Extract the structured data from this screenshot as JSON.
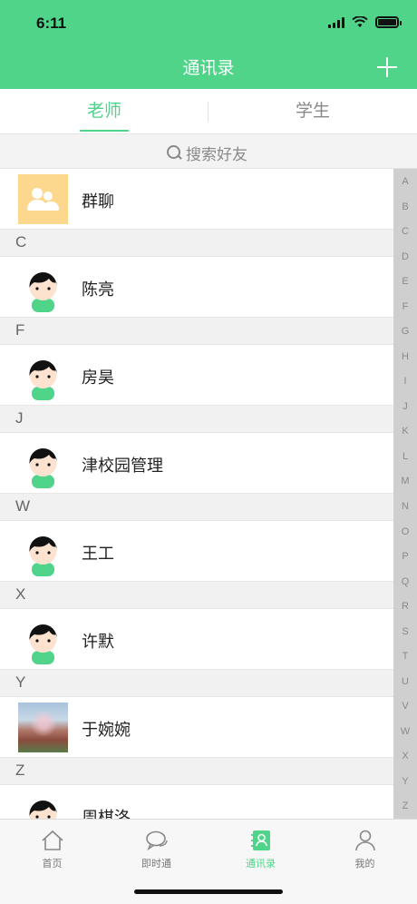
{
  "status_bar": {
    "time": "6:11"
  },
  "nav": {
    "title": "通讯录",
    "add_icon": "plus-icon"
  },
  "tabs": [
    {
      "label": "老师",
      "active": true
    },
    {
      "label": "学生",
      "active": false
    }
  ],
  "search": {
    "placeholder": "搜索好友",
    "icon": "search-icon"
  },
  "contacts": {
    "group": {
      "name": "群聊",
      "avatar": "group-chat-icon"
    },
    "sections": [
      {
        "letter": "C",
        "entries": [
          {
            "name": "陈亮",
            "avatar": "default-avatar"
          }
        ]
      },
      {
        "letter": "F",
        "entries": [
          {
            "name": "房昊",
            "avatar": "default-avatar"
          }
        ]
      },
      {
        "letter": "J",
        "entries": [
          {
            "name": "津校园管理",
            "avatar": "default-avatar"
          }
        ]
      },
      {
        "letter": "W",
        "entries": [
          {
            "name": "王工",
            "avatar": "default-avatar"
          }
        ]
      },
      {
        "letter": "X",
        "entries": [
          {
            "name": "许默",
            "avatar": "default-avatar"
          }
        ]
      },
      {
        "letter": "Y",
        "entries": [
          {
            "name": "于婉婉",
            "avatar": "photo-avatar"
          }
        ]
      },
      {
        "letter": "Z",
        "entries": [
          {
            "name": "周棋洛",
            "avatar": "default-avatar"
          }
        ]
      }
    ]
  },
  "alpha_index": [
    "A",
    "B",
    "C",
    "D",
    "E",
    "F",
    "G",
    "H",
    "I",
    "J",
    "K",
    "L",
    "M",
    "N",
    "O",
    "P",
    "Q",
    "R",
    "S",
    "T",
    "U",
    "V",
    "W",
    "X",
    "Y",
    "Z"
  ],
  "tabbar": [
    {
      "label": "首页",
      "icon": "home-icon",
      "active": false
    },
    {
      "label": "即时通",
      "icon": "chat-icon",
      "active": false
    },
    {
      "label": "通讯录",
      "icon": "contacts-book-icon",
      "active": true
    },
    {
      "label": "我的",
      "icon": "profile-icon",
      "active": false
    }
  ],
  "colors": {
    "accent": "#4fd48a",
    "group_avatar": "#fcd88f",
    "index_bg": "#cfcfcf"
  }
}
